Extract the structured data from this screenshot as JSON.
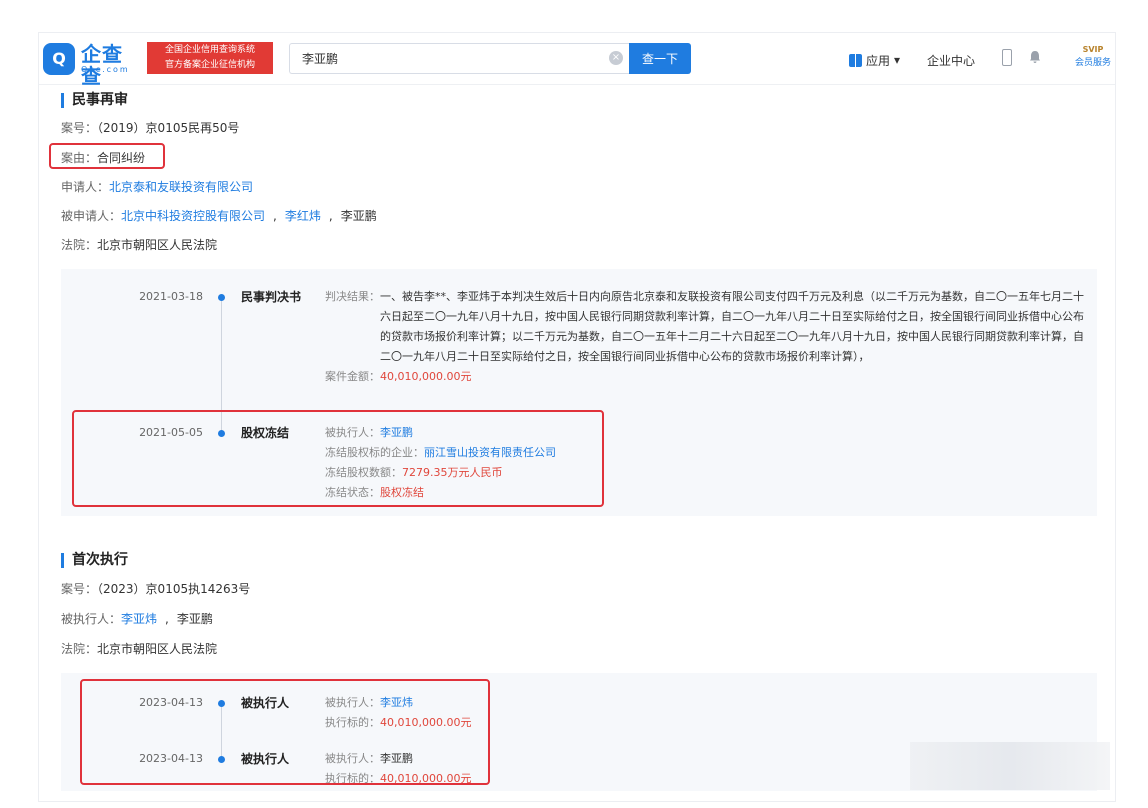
{
  "header": {
    "logo_text": "企查查",
    "logo_sub": "Qcc.com",
    "slogan_line1": "全国企业信用查询系统",
    "slogan_line2": "官方备案企业征信机构",
    "search_value": "李亚鹏",
    "search_button": "查一下",
    "apps_label": "应用",
    "enterprise_center": "企业中心",
    "svip_tag": "SVIP",
    "svip_label": "会员服务"
  },
  "retrial": {
    "title": "民事再审",
    "case_no_label": "案号：",
    "case_no": "（2019）京0105民再50号",
    "cause_label": "案由：",
    "cause": "合同纠纷",
    "applicant_label": "申请人：",
    "applicant": "北京泰和友联投资有限公司",
    "respondent_label": "被申请人：",
    "respondents": [
      "北京中科投资控股有限公司",
      "李红炜",
      "李亚鹏"
    ],
    "court_label": "法院：",
    "court": "北京市朝阳区人民法院",
    "events": [
      {
        "date": "2021-03-18",
        "type": "民事判决书",
        "result_label": "判决结果：",
        "result": "一、被告李**、李亚炜于本判决生效后十日内向原告北京泰和友联投资有限公司支付四千万元及利息（以二千万元为基数，自二〇一五年七月二十六日起至二〇一九年八月十九日，按中国人民银行同期贷款利率计算，自二〇一九年八月二十日至实际给付之日，按全国银行间同业拆借中心公布的贷款市场报价利率计算；以二千万元为基数，自二〇一五年十二月二十六日起至二〇一九年八月十九日，按中国人民银行同期贷款利率计算，自二〇一九年八月二十日至实际给付之日，按全国银行间同业拆借中心公布的贷款市场报价利率计算），",
        "amount_label": "案件金额：",
        "amount": "40,010,000.00元"
      },
      {
        "date": "2021-05-05",
        "type": "股权冻结",
        "executee_label": "被执行人：",
        "executee": "李亚鹏",
        "target_label": "冻结股权标的企业：",
        "target": "丽江雪山投资有限责任公司",
        "frozen_amount_label": "冻结股权数额：",
        "frozen_amount": "7279.35万元人民币",
        "status_label": "冻结状态：",
        "status": "股权冻结"
      }
    ]
  },
  "first_exec": {
    "title": "首次执行",
    "case_no_label": "案号：",
    "case_no": "（2023）京0105执14263号",
    "executee_label": "被执行人：",
    "executees": [
      "李亚炜",
      "李亚鹏"
    ],
    "court_label": "法院：",
    "court": "北京市朝阳区人民法院",
    "events": [
      {
        "date": "2023-04-13",
        "type": "被执行人",
        "executee_label": "被执行人：",
        "executee": "李亚炜",
        "target_label": "执行标的：",
        "target": "40,010,000.00元"
      },
      {
        "date": "2023-04-13",
        "type": "被执行人",
        "executee_label": "被执行人：",
        "executee": "李亚鹏",
        "target_label": "执行标的：",
        "target": "40,010,000.00元"
      }
    ]
  },
  "colors": {
    "accent": "#1f7ce0",
    "highlight_border": "#e0323b",
    "amount_red": "#e0473c"
  }
}
